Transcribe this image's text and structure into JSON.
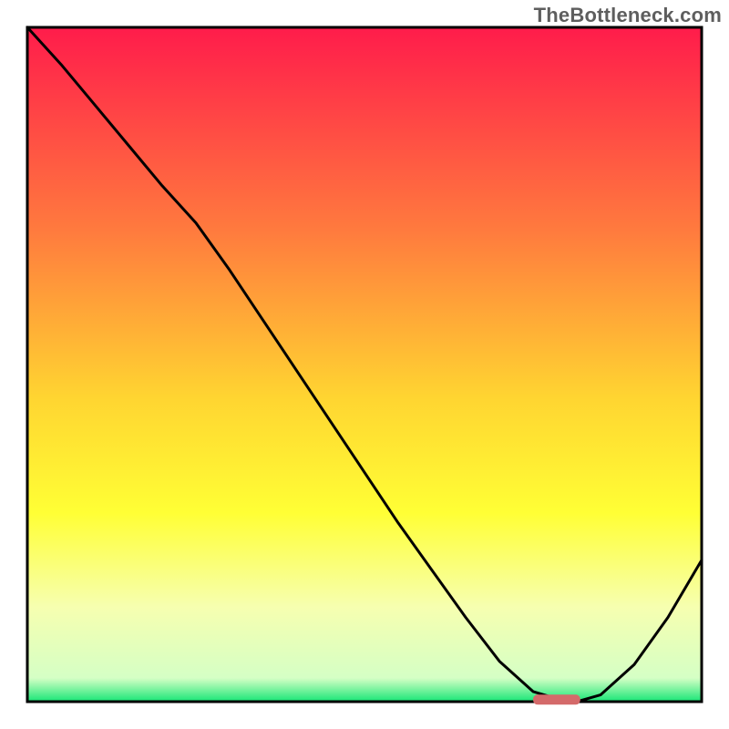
{
  "watermark": "TheBottleneck.com",
  "chart_data": {
    "type": "line",
    "x": [
      0.0,
      0.05,
      0.1,
      0.15,
      0.2,
      0.25,
      0.3,
      0.35,
      0.4,
      0.45,
      0.5,
      0.55,
      0.6,
      0.65,
      0.7,
      0.75,
      0.8,
      0.815,
      0.85,
      0.9,
      0.95,
      1.0
    ],
    "values": [
      1.0,
      0.945,
      0.885,
      0.825,
      0.765,
      0.71,
      0.64,
      0.565,
      0.49,
      0.415,
      0.34,
      0.265,
      0.195,
      0.125,
      0.06,
      0.015,
      0.0,
      0.0,
      0.01,
      0.055,
      0.125,
      0.21
    ],
    "flat_band": {
      "x_start": 0.75,
      "x_end": 0.82,
      "y": 0.003
    },
    "title": "",
    "xlabel": "",
    "ylabel": "",
    "xlim": [
      0,
      1
    ],
    "ylim": [
      0,
      1
    ],
    "background_gradient": {
      "stops": [
        {
          "offset": 0.0,
          "color": "#ff1c4b"
        },
        {
          "offset": 0.3,
          "color": "#ff7a3e"
        },
        {
          "offset": 0.55,
          "color": "#ffd531"
        },
        {
          "offset": 0.72,
          "color": "#ffff35"
        },
        {
          "offset": 0.86,
          "color": "#f6ffb0"
        },
        {
          "offset": 0.965,
          "color": "#d5ffc5"
        },
        {
          "offset": 1.0,
          "color": "#17e676"
        }
      ]
    },
    "marker": {
      "shape": "rounded-rect",
      "color": "#d46a6a"
    }
  },
  "colors": {
    "curve": "#000000",
    "frame": "#000000",
    "marker": "#d46a6a",
    "watermark": "#5e5e5e"
  }
}
